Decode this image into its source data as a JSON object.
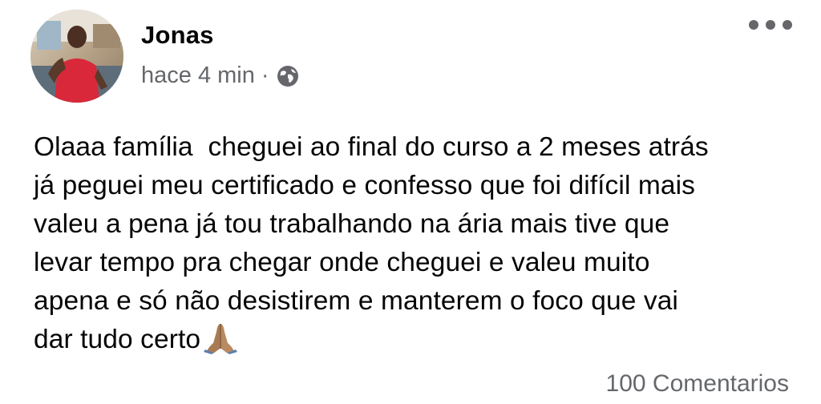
{
  "post": {
    "author": "Jonas",
    "time": "hace 4 min",
    "separator": "·",
    "privacy_icon": "globe-icon",
    "more_icon": "more-options-icon",
    "text_lines": [
      "Olaaa família  cheguei ao final do curso a 2 meses atrás",
      "já peguei meu certificado e confesso que foi difícil mais",
      "valeu a pena já tou trabalhando na ária mais tive que",
      "levar tempo pra chegar onde cheguei e valeu muito",
      "apena e só não desistirem e manterem o foco que vai",
      "dar tudo certo"
    ],
    "text_emoji": "folded-hands-emoji",
    "comments": "100 Comentarios"
  },
  "colors": {
    "text_primary": "#050505",
    "text_secondary": "#65676b",
    "background": "#ffffff"
  }
}
